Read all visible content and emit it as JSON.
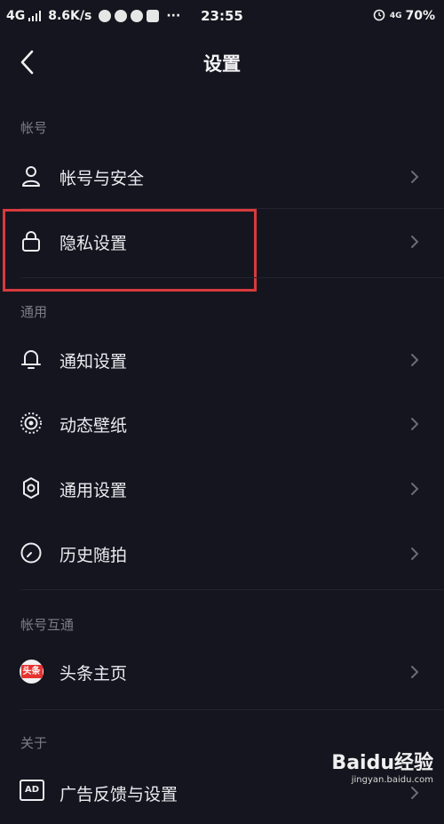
{
  "status_bar": {
    "network": "4G",
    "speed": "8.6K/s",
    "time": "23:55",
    "battery_network": "4G",
    "battery": "70%"
  },
  "header": {
    "title": "设置"
  },
  "sections": {
    "account": {
      "title": "帐号",
      "items": [
        {
          "label": "帐号与安全",
          "icon": "person-icon"
        },
        {
          "label": "隐私设置",
          "icon": "lock-icon"
        }
      ]
    },
    "general": {
      "title": "通用",
      "items": [
        {
          "label": "通知设置",
          "icon": "bell-icon"
        },
        {
          "label": "动态壁纸",
          "icon": "live-wallpaper-icon"
        },
        {
          "label": "通用设置",
          "icon": "gear-icon"
        },
        {
          "label": "历史随拍",
          "icon": "clock-icon"
        }
      ]
    },
    "interop": {
      "title": "帐号互通",
      "items": [
        {
          "label": "头条主页",
          "icon": "toutiao-icon",
          "badge": "头条"
        }
      ]
    },
    "about": {
      "title": "关于",
      "items": [
        {
          "label": "广告反馈与设置",
          "icon": "ad-icon",
          "badge": "AD"
        }
      ]
    }
  },
  "colors": {
    "background": "#15151f",
    "highlight": "#d83a3c",
    "muted": "#7d7d86"
  },
  "watermark": {
    "text": "Baidu经验",
    "sub": "jingyan.baidu.com"
  }
}
